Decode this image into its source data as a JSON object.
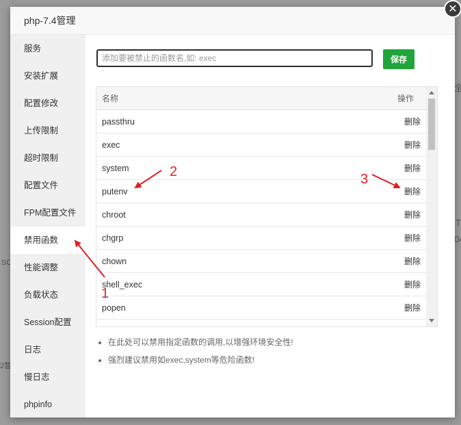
{
  "modal": {
    "title": "php-7.4管理",
    "close_glyph": "✕"
  },
  "sidebar": {
    "items": [
      {
        "label": "服务"
      },
      {
        "label": "安装扩展"
      },
      {
        "label": "配置修改"
      },
      {
        "label": "上传限制"
      },
      {
        "label": "超时限制"
      },
      {
        "label": "配置文件"
      },
      {
        "label": "FPM配置文件"
      },
      {
        "label": "禁用函数",
        "active": true
      },
      {
        "label": "性能调整"
      },
      {
        "label": "负载状态"
      },
      {
        "label": "Session配置"
      },
      {
        "label": "日志"
      },
      {
        "label": "慢日志"
      },
      {
        "label": "phpinfo"
      }
    ]
  },
  "content": {
    "input": {
      "placeholder": "添加要被禁止的函数名,如: exec",
      "value": ""
    },
    "save_label": "保存",
    "table": {
      "headers": {
        "name": "名称",
        "op": "操作"
      },
      "rows": [
        {
          "name": "passthru",
          "action": "删除"
        },
        {
          "name": "exec",
          "action": "删除"
        },
        {
          "name": "system",
          "action": "删除"
        },
        {
          "name": "putenv",
          "action": "删除"
        },
        {
          "name": "chroot",
          "action": "删除"
        },
        {
          "name": "chgrp",
          "action": "删除"
        },
        {
          "name": "chown",
          "action": "删除"
        },
        {
          "name": "shell_exec",
          "action": "删除"
        },
        {
          "name": "popen",
          "action": "删除"
        },
        {
          "name": "",
          "action": ""
        }
      ]
    },
    "tips": [
      "在此处可以禁用指定函数的调用,以增强环境安全性!",
      "强烈建议禁用如exec,system等危险函数!"
    ]
  },
  "annotations": {
    "one": "1",
    "two": "2",
    "three": "3",
    "color": "#e31e1e"
  },
  "colors": {
    "accent": "#20a53a",
    "overlay": "#9c9c9c"
  },
  "background_fragments": [
    "全",
    "T",
    "04",
    "SO",
    "2暂"
  ]
}
